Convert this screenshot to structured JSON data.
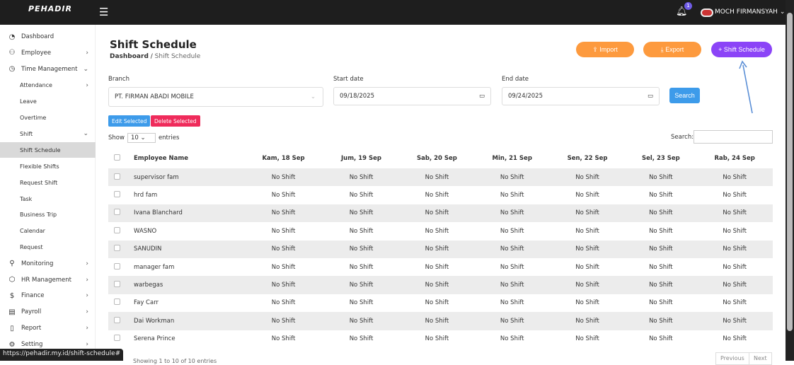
{
  "topbar": {
    "logo": "PEHADIR",
    "notification_count": "1",
    "user_name": "MOCH FIRMANSYAH"
  },
  "sidebar": {
    "items": [
      {
        "label": "Dashboard",
        "icon": "gauge-icon",
        "chevron": ""
      },
      {
        "label": "Employee",
        "icon": "users-icon",
        "chevron": ">"
      },
      {
        "label": "Time Management",
        "icon": "clock-icon",
        "chevron": "v"
      },
      {
        "label": "Attendance",
        "sub": true,
        "chevron": ">"
      },
      {
        "label": "Leave",
        "sub": true,
        "chevron": ""
      },
      {
        "label": "Overtime",
        "sub": true,
        "chevron": ""
      },
      {
        "label": "Shift",
        "sub": true,
        "chevron": "v"
      },
      {
        "label": "Shift Schedule",
        "sub": true,
        "active": true,
        "chevron": ""
      },
      {
        "label": "Flexible Shifts",
        "sub": true,
        "chevron": ""
      },
      {
        "label": "Request Shift",
        "sub": true,
        "chevron": ""
      },
      {
        "label": "Task",
        "sub": true,
        "chevron": ""
      },
      {
        "label": "Business Trip",
        "sub": true,
        "chevron": ""
      },
      {
        "label": "Calendar",
        "sub": true,
        "chevron": ""
      },
      {
        "label": "Request",
        "sub": true,
        "chevron": ""
      },
      {
        "label": "Monitoring",
        "icon": "location-icon",
        "chevron": ">"
      },
      {
        "label": "HR Management",
        "icon": "cube-icon",
        "chevron": ">"
      },
      {
        "label": "Finance",
        "icon": "dollar-icon",
        "chevron": ">"
      },
      {
        "label": "Payroll",
        "icon": "book-icon",
        "chevron": ">"
      },
      {
        "label": "Report",
        "icon": "file-icon",
        "chevron": ">"
      },
      {
        "label": "Setting",
        "icon": "gear-icon",
        "chevron": ">"
      }
    ]
  },
  "status_url": "https://pehadir.my.id/shift-schedule#",
  "page": {
    "title": "Shift Schedule",
    "breadcrumb_home": "Dashboard",
    "breadcrumb_current": "Shift Schedule"
  },
  "buttons": {
    "import": "Import",
    "export": "Export",
    "add": "+ Shift Schedule",
    "search": "Search",
    "edit_selected": "Edit Selected",
    "delete_selected": "Delete Selected"
  },
  "colors": {
    "orange": "#fd9a3e",
    "purple": "#8b44f7",
    "blue": "#3d9bea",
    "red": "#ef2b5b"
  },
  "filters": {
    "branch_label": "Branch",
    "branch_value": "PT. FIRMAN ABADI MOBILE",
    "start_label": "Start date",
    "start_value": "09/18/2025",
    "end_label": "End date",
    "end_value": "09/24/2025"
  },
  "table": {
    "show_label": "Show",
    "entries_value": "10",
    "entries_label": "entries",
    "search_label": "Search:",
    "columns": [
      "Employee Name",
      "Kam, 18 Sep",
      "Jum, 19 Sep",
      "Sab, 20 Sep",
      "Min, 21 Sep",
      "Sen, 22 Sep",
      "Sel, 23 Sep",
      "Rab, 24 Sep"
    ],
    "rows": [
      "supervisor fam",
      "hrd fam",
      "Ivana Blanchard",
      "WASNO",
      "SANUDIN",
      "manager fam",
      "warbegas",
      "Fay Carr",
      "Dai Workman",
      "Serena Prince"
    ],
    "cell_value": "No Shift",
    "info": "Showing 1 to 10 of 10 entries",
    "prev": "Previous",
    "next": "Next"
  }
}
